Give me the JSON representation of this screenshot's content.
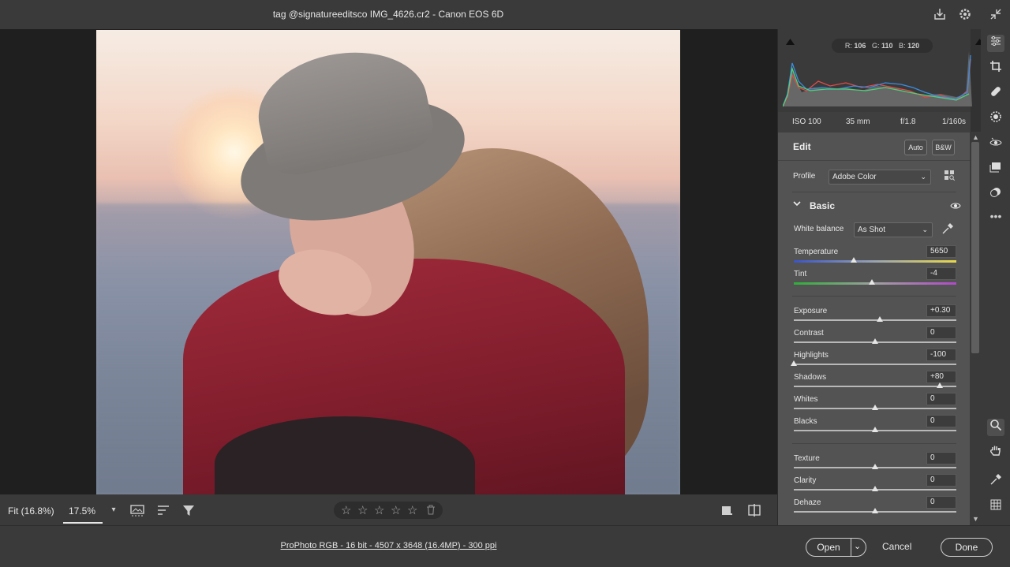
{
  "window": {
    "title": "tag @signatureeditsco IMG_4626.cr2  -  Canon EOS 6D"
  },
  "titlebar_icons": [
    "save-icon",
    "gear-icon",
    "collapse-icon"
  ],
  "bottombar": {
    "fit_label": "Fit (16.8%)",
    "zoom_value": "17.5%",
    "rating_stars": 0
  },
  "histogram": {
    "readout": {
      "r_label": "R:",
      "r": "106",
      "g_label": "G:",
      "g": "110",
      "b_label": "B:",
      "b": "120"
    }
  },
  "exif": {
    "iso": "ISO 100",
    "focal": "35 mm",
    "aperture": "f/1.8",
    "shutter": "1/160s"
  },
  "edit": {
    "title": "Edit",
    "auto_label": "Auto",
    "bw_label": "B&W",
    "profile_label": "Profile",
    "profile_value": "Adobe Color"
  },
  "basic": {
    "title": "Basic",
    "wb_label": "White balance",
    "wb_value": "As Shot",
    "sliders": [
      {
        "label": "Temperature",
        "value": "5650",
        "pos": 0.37,
        "gradient": "temp"
      },
      {
        "label": "Tint",
        "value": "-4",
        "pos": 0.48,
        "gradient": "tint"
      },
      {
        "label": "Exposure",
        "value": "+0.30",
        "pos": 0.53
      },
      {
        "label": "Contrast",
        "value": "0",
        "pos": 0.5
      },
      {
        "label": "Highlights",
        "value": "-100",
        "pos": 0.0
      },
      {
        "label": "Shadows",
        "value": "+80",
        "pos": 0.9
      },
      {
        "label": "Whites",
        "value": "0",
        "pos": 0.5
      },
      {
        "label": "Blacks",
        "value": "0",
        "pos": 0.5
      },
      {
        "label": "Texture",
        "value": "0",
        "pos": 0.5
      },
      {
        "label": "Clarity",
        "value": "0",
        "pos": 0.5
      },
      {
        "label": "Dehaze",
        "value": "0",
        "pos": 0.5
      }
    ]
  },
  "footer": {
    "workflow_info": "ProPhoto RGB - 16 bit - 4507 x 3648 (16.4MP) - 300 ppi",
    "open_label": "Open",
    "cancel_label": "Cancel",
    "done_label": "Done"
  },
  "right_toolbar": [
    "edit-sliders-icon",
    "crop-icon",
    "healing-icon",
    "mask-icon",
    "redeye-icon",
    "snapshots-icon",
    "presets-icon",
    "more-icon",
    "zoom-icon",
    "hand-icon",
    "color-sampler-icon",
    "grid-icon"
  ]
}
